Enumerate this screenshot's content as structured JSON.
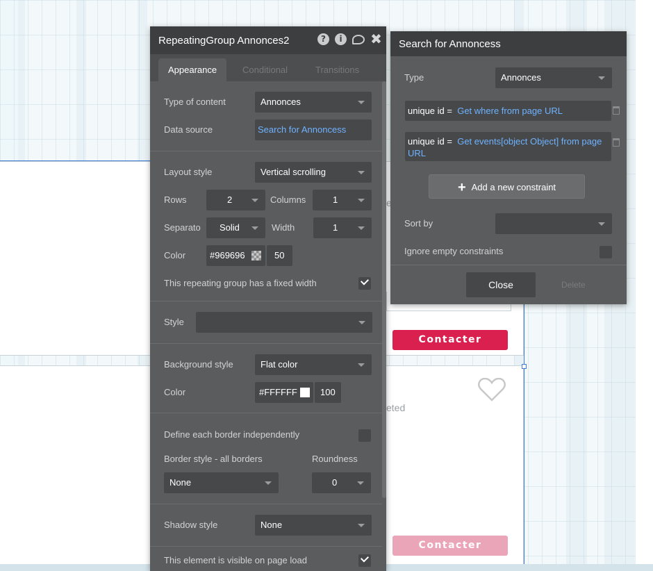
{
  "canvas": {
    "contact_button_label": "Contacter",
    "contact_color": "#d9204f",
    "contact_color_faded": "#eba5b8",
    "fragment_e": "e",
    "fragment_eted": "eted"
  },
  "main_panel": {
    "title": "RepeatingGroup Annonces2",
    "header_icons": [
      "help-icon",
      "info-icon",
      "comment-icon",
      "close-icon"
    ],
    "help_glyph": "?",
    "info_glyph": "i",
    "close_glyph": "✖",
    "tabs": [
      {
        "label": "Appearance",
        "active": true
      },
      {
        "label": "Conditional",
        "active": false
      },
      {
        "label": "Transitions",
        "active": false
      }
    ],
    "type_of_content_label": "Type of content",
    "type_of_content_value": "Annonces",
    "data_source_label": "Data source",
    "data_source_value": "Search for Annoncess",
    "layout_style_label": "Layout style",
    "layout_style_value": "Vertical scrolling",
    "rows_label": "Rows",
    "rows_value": "2",
    "columns_label": "Columns",
    "columns_value": "1",
    "separator_label": "Separato",
    "separator_value": "Solid",
    "width_label": "Width",
    "width_value": "1",
    "color_label": "Color",
    "separator_color_value": "#969696",
    "separator_color_hex": "#969696",
    "separator_opacity": "50",
    "fixed_width_label": "This repeating group has a fixed width",
    "fixed_width_checked": true,
    "style_label": "Style",
    "style_value": "",
    "background_style_label": "Background style",
    "background_style_value": "Flat color",
    "bg_color_label": "Color",
    "bg_color_value": "#FFFFFF",
    "bg_color_hex": "#FFFFFF",
    "bg_opacity": "100",
    "define_border_label": "Define each border independently",
    "border_style_label": "Border style - all borders",
    "border_style_value": "None",
    "roundness_label": "Roundness",
    "roundness_value": "0",
    "shadow_style_label": "Shadow style",
    "shadow_style_value": "None",
    "visible_on_load_label": "This element is visible on page load",
    "visible_on_load_checked": true
  },
  "search_panel": {
    "title": "Search for Annoncess",
    "type_label": "Type",
    "type_value": "Annonces",
    "constraints": [
      {
        "field": "unique id =",
        "expression": "Get where from page URL"
      },
      {
        "field": "unique id =",
        "expression": "Get events[object Object] from page URL"
      }
    ],
    "add_constraint_label": "Add a new constraint",
    "sort_by_label": "Sort by",
    "sort_by_value": "",
    "ignore_empty_label": "Ignore empty constraints",
    "close_label": "Close",
    "delete_label": "Delete"
  }
}
